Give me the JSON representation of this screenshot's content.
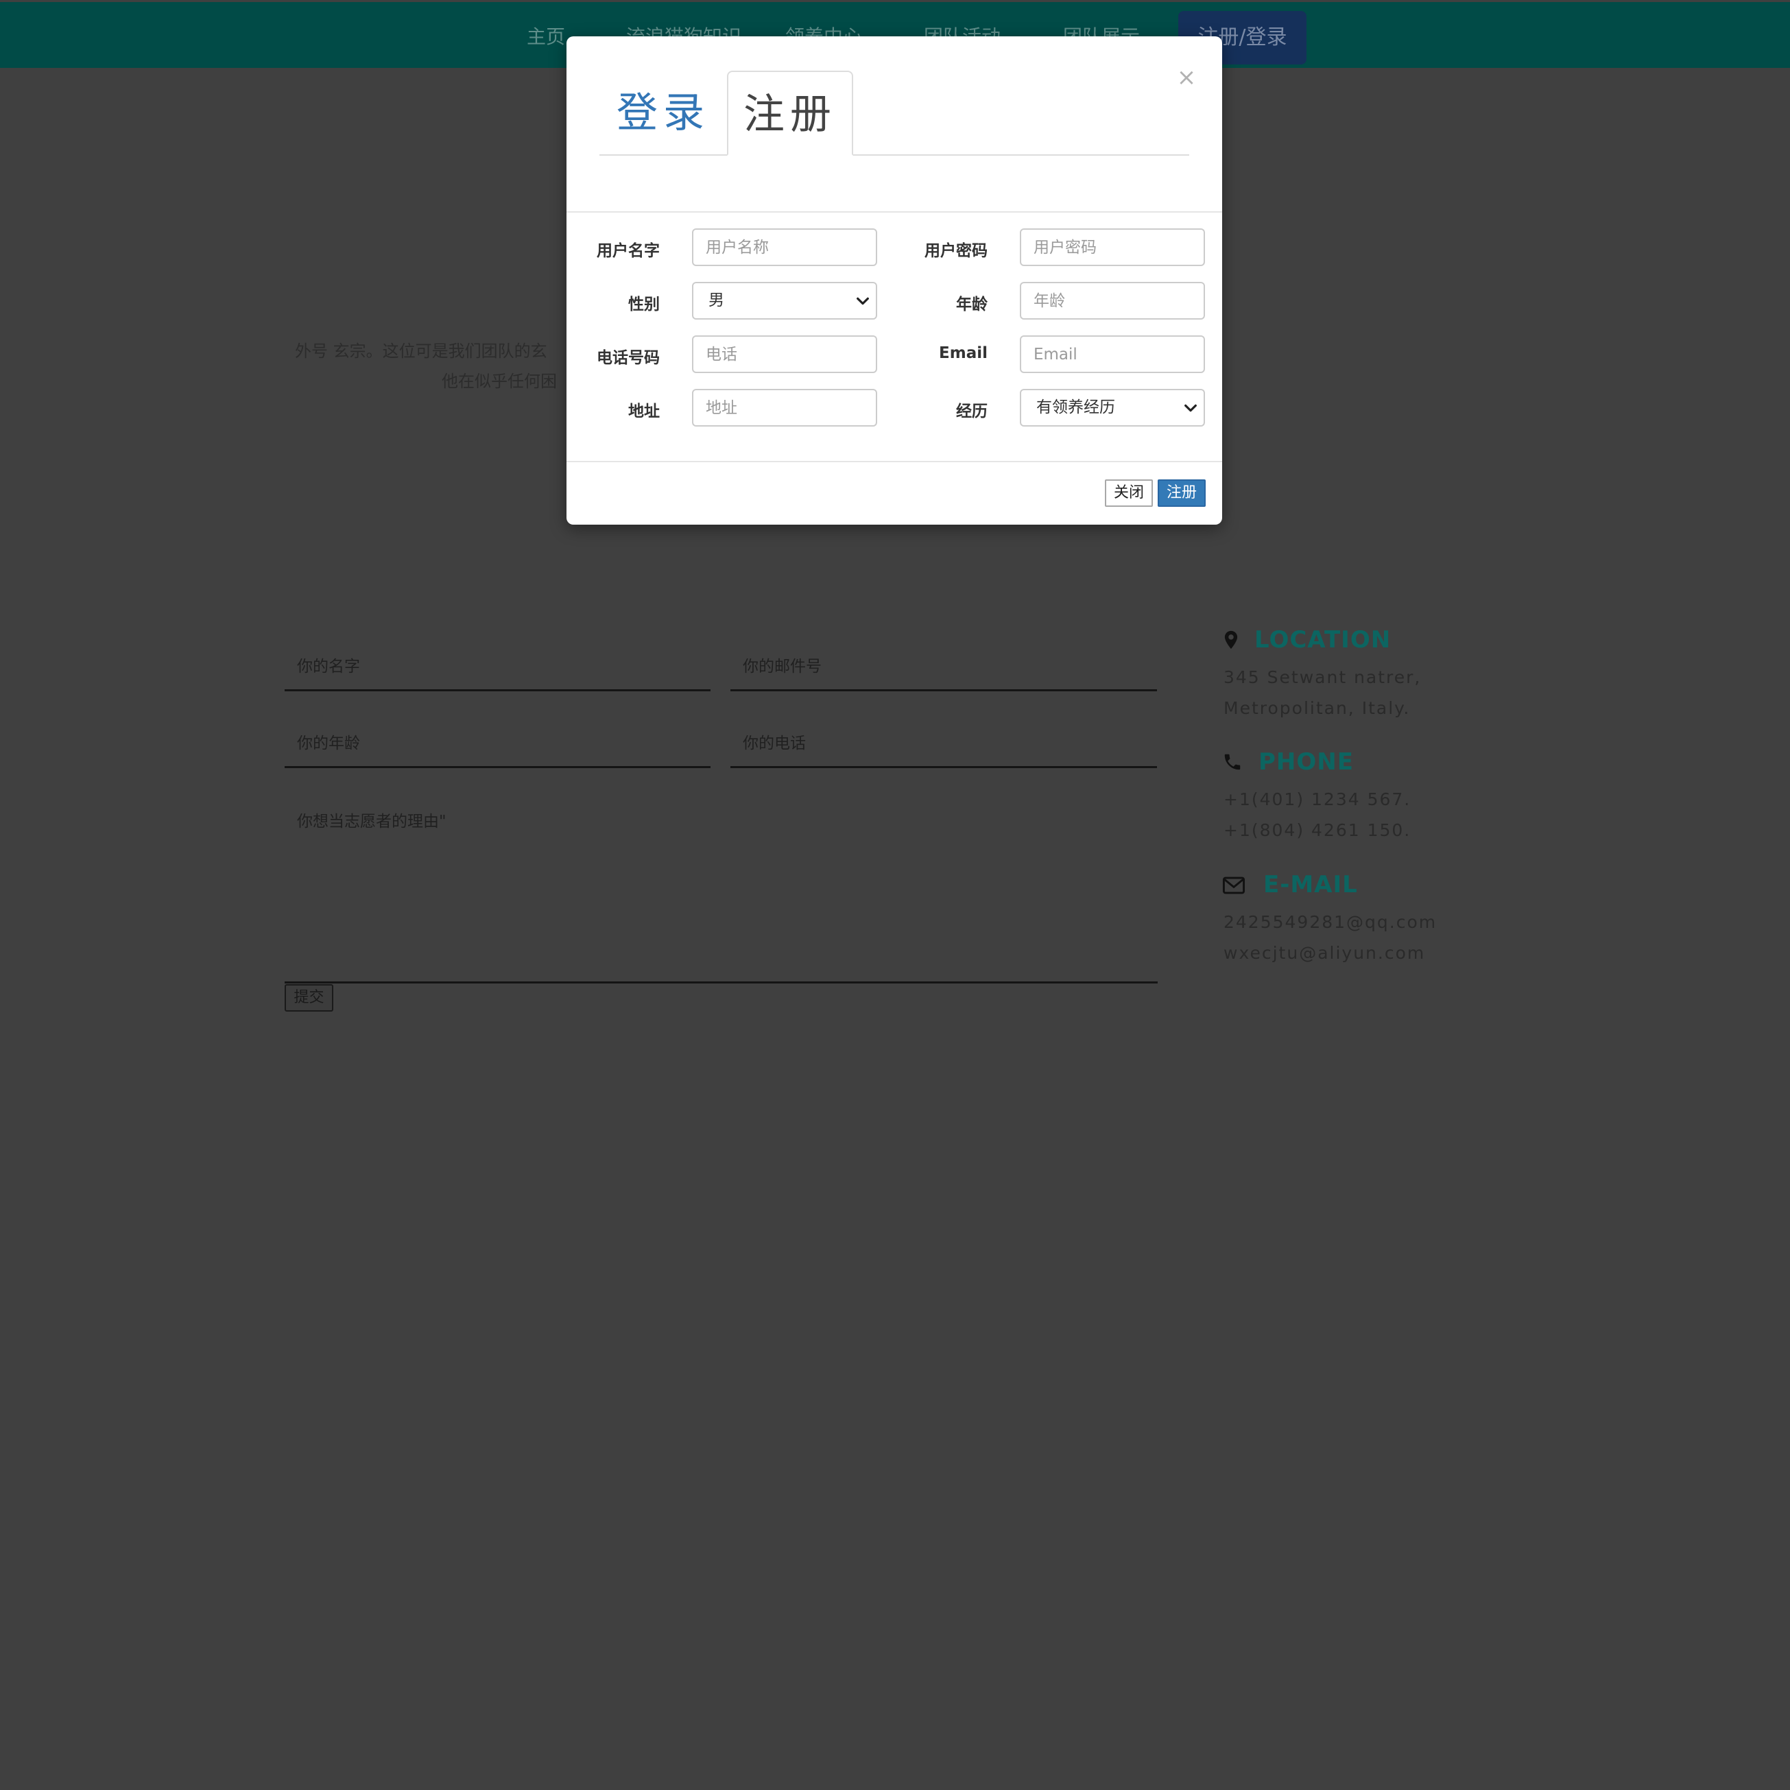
{
  "nav": {
    "items": [
      "主页",
      "流浪猫狗知识",
      "领养中心",
      "团队活动",
      "团队展示"
    ],
    "register_login": "注册/登录"
  },
  "background": {
    "bio_line1": "外号 玄宗。这位可是我们团队的玄",
    "bio_line2": "他在似乎任何困",
    "form": {
      "name_placeholder": "你的名字",
      "email_placeholder": "你的邮件号",
      "age_placeholder": "你的年龄",
      "phone_placeholder": "你的电话",
      "reason_placeholder": "你想当志愿者的理由\"",
      "submit_label": "提交"
    },
    "contact": {
      "location": {
        "heading": "LOCATION",
        "lines": [
          "345 Setwant natrer,",
          "Metropolitan, Italy."
        ]
      },
      "phone": {
        "heading": "PHONE",
        "lines": [
          "+1(401) 1234 567.",
          "+1(804) 4261 150."
        ]
      },
      "email": {
        "heading": "E-MAIL",
        "lines": [
          "2425549281@qq.com",
          "wxecjtu@aliyun.com"
        ]
      }
    }
  },
  "modal": {
    "close_glyph": "×",
    "tabs": {
      "login": "登录",
      "register": "注册"
    },
    "fields": {
      "username": {
        "label": "用户名字",
        "placeholder": "用户名称"
      },
      "password": {
        "label": "用户密码",
        "placeholder": "用户密码"
      },
      "gender": {
        "label": "性别",
        "value": "男"
      },
      "age": {
        "label": "年龄",
        "placeholder": "年龄"
      },
      "phone": {
        "label": "电话号码",
        "placeholder": "电话"
      },
      "email": {
        "label": "Email",
        "placeholder": "Email"
      },
      "address": {
        "label": "地址",
        "placeholder": "地址"
      },
      "experience": {
        "label": "经历",
        "value": "有领养经历"
      }
    },
    "buttons": {
      "close": "关闭",
      "register": "注册"
    }
  },
  "colors": {
    "navbar": "#014b47",
    "accent_blue": "#337ab7",
    "contact_heading": "#0c6561",
    "overlay_bg": "#404040"
  },
  "icons": [
    "map-marker-icon",
    "phone-icon",
    "envelope-icon",
    "close-icon",
    "chevron-down-icon"
  ]
}
